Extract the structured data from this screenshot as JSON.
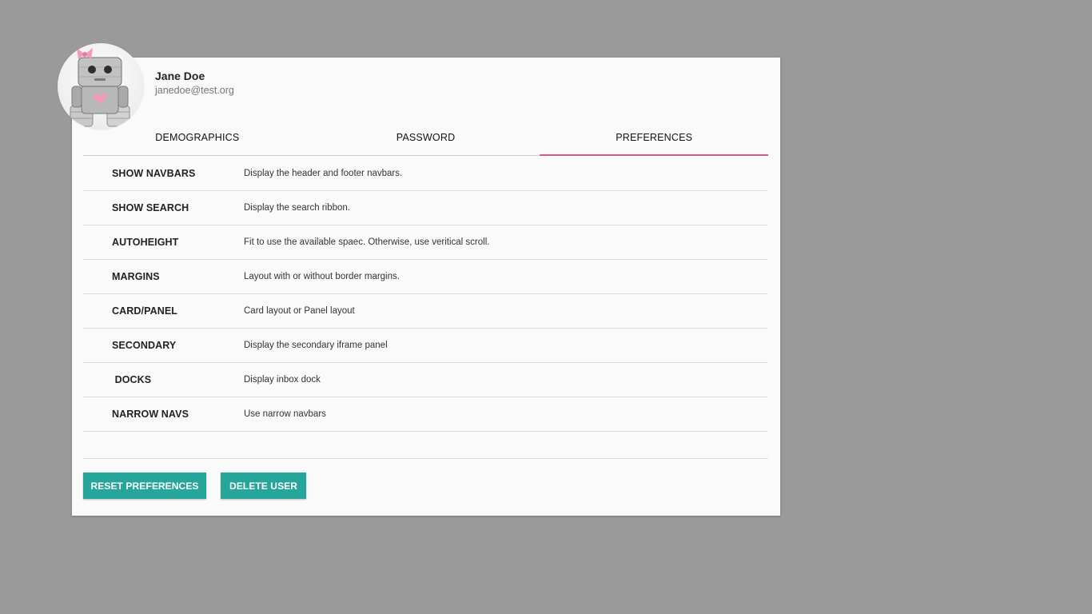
{
  "user": {
    "name": "Jane Doe",
    "email": "janedoe@test.org"
  },
  "tabs": [
    {
      "label": "DEMOGRAPHICS",
      "active": false
    },
    {
      "label": "PASSWORD",
      "active": false
    },
    {
      "label": "PREFERENCES",
      "active": true
    }
  ],
  "preferences": [
    {
      "label": "SHOW NAVBARS",
      "description": "Display the header and footer navbars."
    },
    {
      "label": "SHOW SEARCH",
      "description": "Display the search ribbon."
    },
    {
      "label": "AUTOHEIGHT",
      "description": "Fit to use the available spaec. Otherwise, use veritical scroll."
    },
    {
      "label": "MARGINS",
      "description": "Layout with or without border margins."
    },
    {
      "label": "CARD/PANEL",
      "description": "Card layout or Panel layout"
    },
    {
      "label": "SECONDARY",
      "description": "Display the secondary iframe panel"
    },
    {
      "label": " DOCKS",
      "description": "Display inbox dock"
    },
    {
      "label": "NARROW NAVS",
      "description": "Use narrow navbars"
    }
  ],
  "actions": {
    "reset_label": "RESET PREFERENCES",
    "delete_label": "DELETE USER"
  },
  "colors": {
    "accent_tab": "#e05a7d",
    "button": "#26a69a",
    "backdrop": "#9a9a9a"
  },
  "icons": {
    "avatar": "robot-plush-avatar"
  }
}
